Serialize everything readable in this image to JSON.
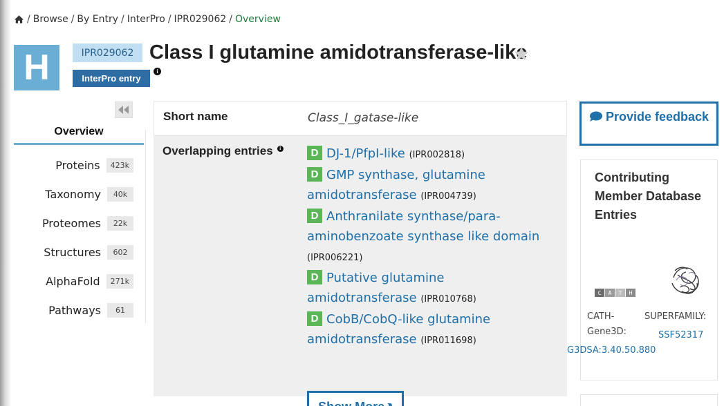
{
  "breadcrumb": {
    "items": [
      "Browse",
      "By Entry",
      "InterPro",
      "IPR029062"
    ],
    "current": "Overview"
  },
  "header": {
    "type_letter": "H",
    "accession": "IPR029062",
    "entry_type": "InterPro entry",
    "title": "Class I glutamine amidotransferase-like"
  },
  "sidebar": {
    "active": "Overview",
    "items": [
      {
        "label": "Proteins",
        "count": "423k"
      },
      {
        "label": "Taxonomy",
        "count": "40k"
      },
      {
        "label": "Proteomes",
        "count": "22k"
      },
      {
        "label": "Structures",
        "count": "602"
      },
      {
        "label": "AlphaFold",
        "count": "271k"
      },
      {
        "label": "Pathways",
        "count": "61"
      }
    ]
  },
  "main": {
    "short_name_label": "Short name",
    "short_name_value": "Class_I_gatase-like",
    "overlapping_label": "Overlapping entries",
    "overlapping": [
      {
        "badge": "D",
        "name": "DJ-1/PfpI-like",
        "acc": "(IPR002818)"
      },
      {
        "badge": "D",
        "name": "GMP synthase, glutamine amidotransferase",
        "acc": "(IPR004739)"
      },
      {
        "badge": "D",
        "name": "Anthranilate synthase/para-aminobenzoate synthase like domain",
        "acc": "(IPR006221)"
      },
      {
        "badge": "D",
        "name": "Putative glutamine amidotransferase",
        "acc": "(IPR010768)"
      },
      {
        "badge": "D",
        "name": "CobB/CobQ-like glutamine amidotransferase",
        "acc": "(IPR011698)"
      }
    ],
    "show_more": "Show More"
  },
  "right_panel": {
    "feedback": "Provide feedback",
    "contrib_title": "Contributing Member Database Entries",
    "cath_logo_letters": [
      "C",
      "A",
      "T",
      "H"
    ],
    "cath_label": "CATH-Gene3D:",
    "cath_link": "G3DSA:3.40.50.880",
    "superfamily_label": "SUPERFAMILY:",
    "superfamily_link": "SSF52317"
  }
}
